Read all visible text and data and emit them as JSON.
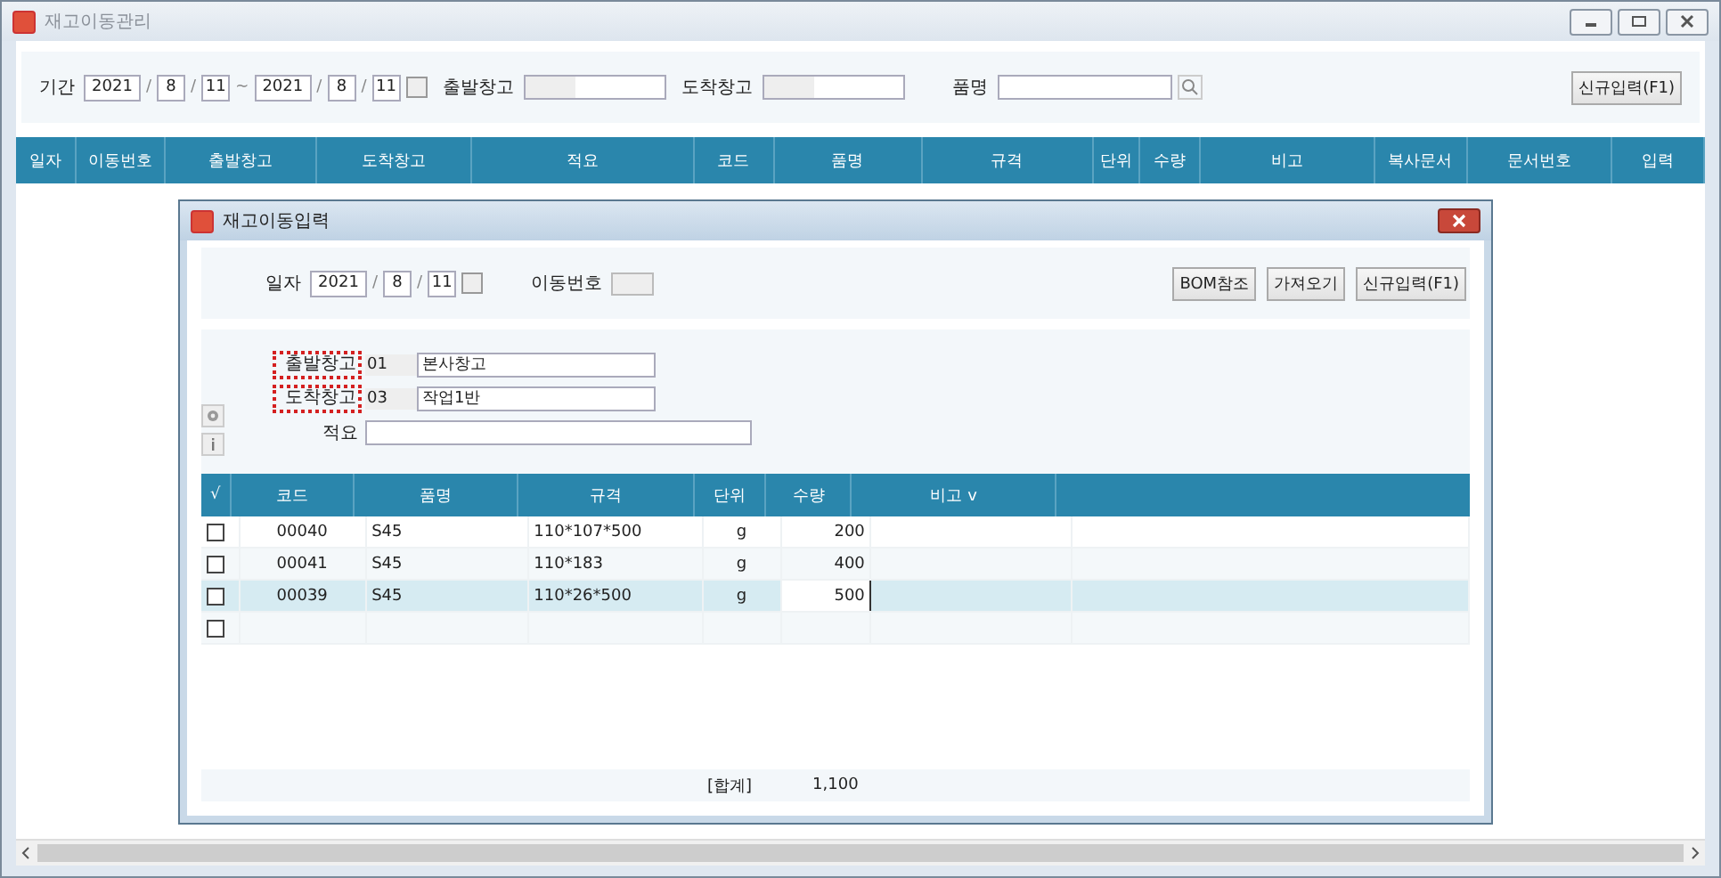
{
  "window": {
    "title": "재고이동관리"
  },
  "filters": {
    "period_label": "기간",
    "from": [
      "2021",
      "8",
      "11"
    ],
    "range_sep": "~",
    "to": [
      "2021",
      "8",
      "11"
    ],
    "date_sep": "/",
    "from_wh_label": "출발창고",
    "to_wh_label": "도착창고",
    "item_label": "품명"
  },
  "new_button": "신규입력(F1)",
  "table": {
    "columns": [
      "일자",
      "이동번호",
      "출발창고",
      "도착창고",
      "적요",
      "코드",
      "품명",
      "규격",
      "단위",
      "수량",
      "비고",
      "복사문서",
      "문서번호",
      "입력"
    ]
  },
  "dialog": {
    "title": "재고이동입력",
    "date_label": "일자",
    "date": [
      "2021",
      "8",
      "11"
    ],
    "date_sep": "/",
    "move_no_label": "이동번호",
    "buttons": [
      "BOM참조",
      "가져오기",
      "신규입력(F1)"
    ],
    "fields": [
      {
        "label": "출발창고",
        "highlighted": true,
        "code": "01",
        "name": "본사창고"
      },
      {
        "label": "도착창고",
        "highlighted": true,
        "code": "03",
        "name": "작업1반"
      }
    ],
    "memo_label": "적요",
    "grid": {
      "columns": [
        "√",
        "코드",
        "품명",
        "규격",
        "단위",
        "수량",
        "비고 v"
      ],
      "rows": [
        {
          "checked": false,
          "selected": false,
          "cells": [
            "",
            "00040",
            "S45",
            "110*107*500",
            "g",
            "200"
          ]
        },
        {
          "checked": false,
          "selected": false,
          "cells": [
            "",
            "00041",
            "S45",
            "110*183",
            "g",
            "400"
          ]
        },
        {
          "checked": false,
          "selected": true,
          "cells": [
            "",
            "00039",
            "S45",
            "110*26*500",
            "g",
            "500"
          ]
        },
        {
          "checked": false,
          "selected": false,
          "cells": []
        }
      ]
    },
    "total_label": "[합계]",
    "total": "1,100"
  }
}
